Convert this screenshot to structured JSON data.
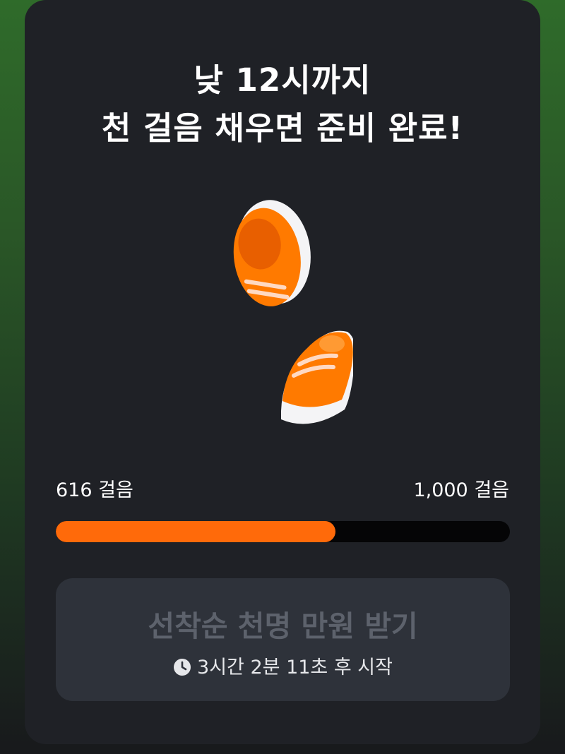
{
  "title": {
    "line1": "낮 12시까지",
    "line2": "천 걸음 채우면 준비 완료!"
  },
  "illustration": {
    "icon": "orange-sneakers-icon",
    "color": "#ff7a00"
  },
  "progress": {
    "current_label": "616 걸음",
    "goal_label": "1,000 걸음",
    "current": 616,
    "goal": 1000,
    "fill_color": "#ff6a0a"
  },
  "cta": {
    "label": "선착순 천명 만원 받기",
    "timer_text": "3시간 2분 11초 후 시작",
    "timer_icon": "clock-icon"
  }
}
